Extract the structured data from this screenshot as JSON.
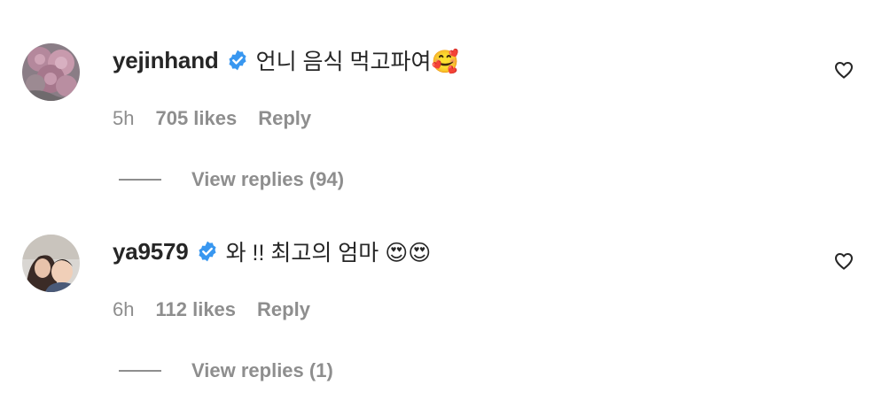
{
  "comments": [
    {
      "username": "yejinhand",
      "verified": true,
      "text": "언니 음식 먹고파여🥰",
      "time": "5h",
      "likes": "705 likes",
      "reply_label": "Reply",
      "view_replies": "View replies (94)",
      "like_icon": "heart-outline-icon",
      "avatar_icon": "flower-avatar"
    },
    {
      "username": "ya9579",
      "verified": true,
      "text": "와 !! 최고의 엄마 😍😍",
      "time": "6h",
      "likes": "112 likes",
      "reply_label": "Reply",
      "view_replies": "View replies (1)",
      "like_icon": "heart-outline-icon",
      "avatar_icon": "photo-avatar"
    }
  ],
  "colors": {
    "primary_text": "#262626",
    "secondary_text": "#8e8e8e",
    "verified_blue": "#3897f0"
  }
}
